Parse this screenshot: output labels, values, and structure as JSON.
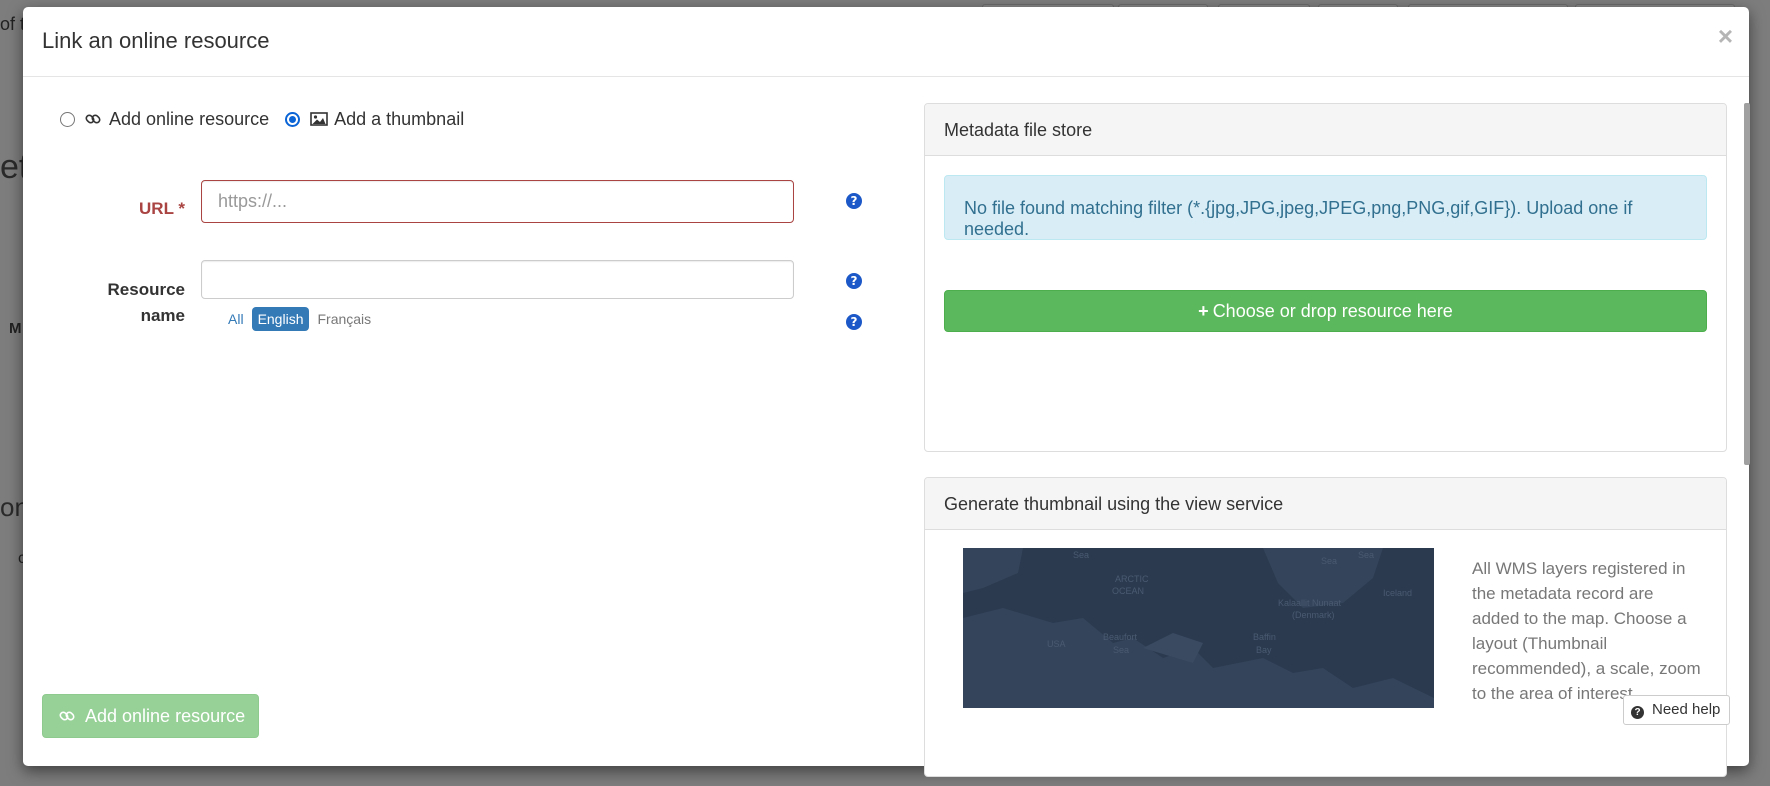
{
  "background": {
    "fragments": [
      "of t",
      "et",
      "M",
      "on",
      "c"
    ]
  },
  "modal": {
    "title": "Link an online resource",
    "close_label": "×",
    "type_options": [
      {
        "label": "Add online resource",
        "icon": "link-icon",
        "checked": false
      },
      {
        "label": "Add a thumbnail",
        "icon": "image-icon",
        "checked": true
      }
    ],
    "url_field": {
      "label": "URL *",
      "placeholder": "https://...",
      "value": ""
    },
    "name_field": {
      "label_line1": "Resource",
      "label_line2": "name",
      "value": ""
    },
    "languages": [
      {
        "label": "All",
        "active": false
      },
      {
        "label": "English",
        "active": true
      },
      {
        "label": "Français",
        "active": false
      }
    ],
    "file_store": {
      "heading": "Metadata file store",
      "alert": "No file found matching filter (*.{jpg,JPG,jpeg,JPEG,png,PNG,gif,GIF}). Upload one if needed.",
      "drop_button": "Choose or drop resource here"
    },
    "thumbnail": {
      "heading": "Generate thumbnail using the view service",
      "description": "All WMS layers registered in the metadata record are added to the map. Choose a layout (Thumbnail recommended), a scale, zoom to the area of interest",
      "map_labels": [
        "ARCTIC",
        "OCEAN",
        "Kalaallit Nunaat",
        "(Denmark)",
        "USA",
        "Beaufort",
        "Sea",
        "Baffin",
        "Bay",
        "Iceland",
        "Sea",
        "Sea",
        "Sea"
      ]
    },
    "footer": {
      "submit_label": "Add online resource",
      "help_label": "Need help"
    }
  },
  "colors": {
    "accent": "#337ab7",
    "success": "#5cb85c",
    "danger": "#a94442",
    "info_bg": "#d9edf7"
  }
}
